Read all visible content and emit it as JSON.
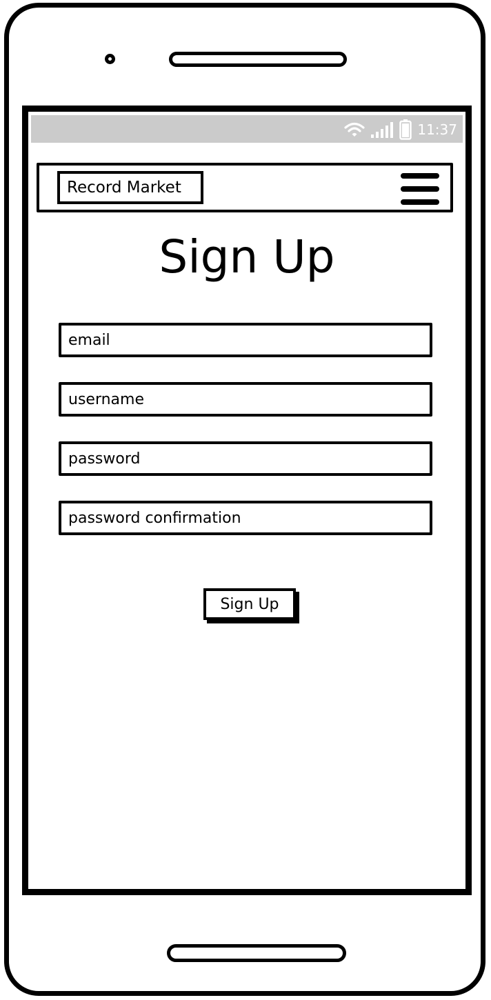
{
  "status_bar": {
    "time": "11:37",
    "icons": [
      "wifi-icon",
      "signal-icon",
      "battery-icon"
    ],
    "background": "#cbcbcb"
  },
  "navbar": {
    "brand": "Record Market",
    "menu_icon": "hamburger-menu-icon"
  },
  "page": {
    "title": "Sign Up"
  },
  "form": {
    "email_placeholder": "email",
    "username_placeholder": "username",
    "password_placeholder": "password",
    "password_confirmation_placeholder": "password confirmation",
    "submit_label": "Sign Up"
  }
}
